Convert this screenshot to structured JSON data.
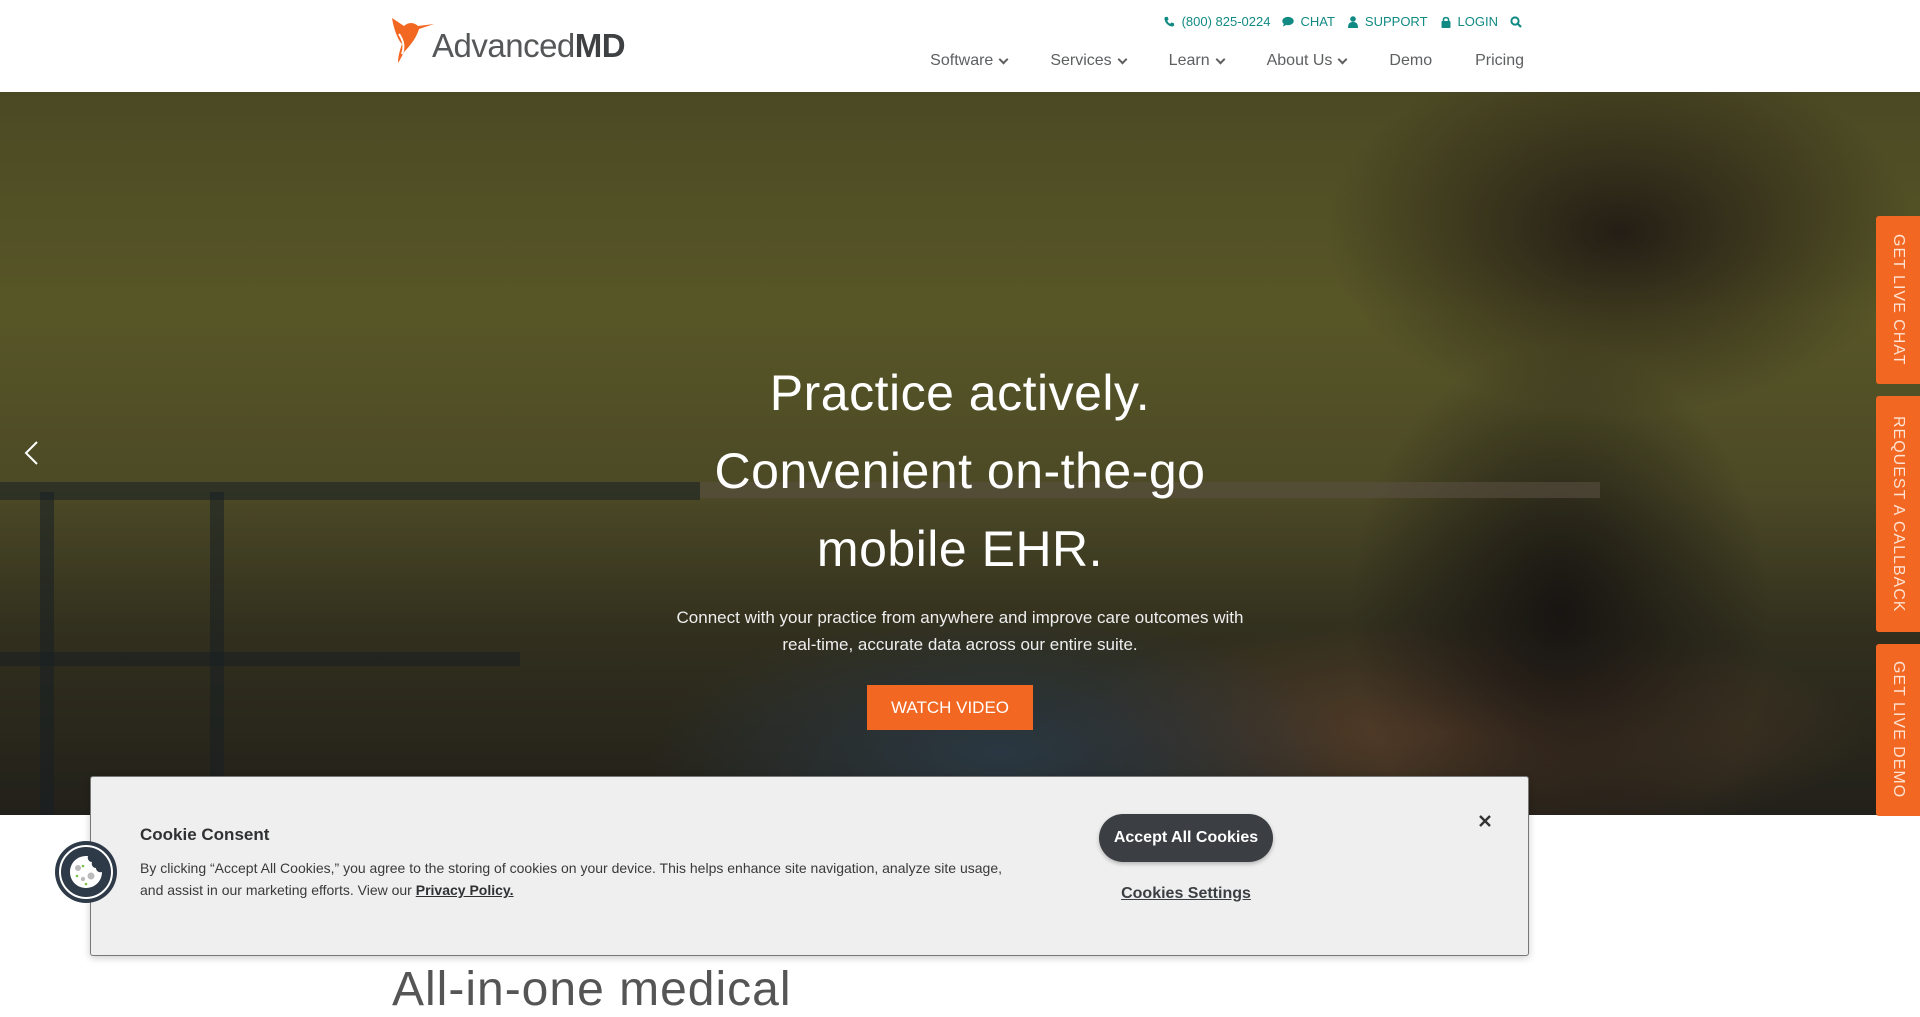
{
  "brand": {
    "name_light": "Advanced",
    "name_bold": "MD",
    "accent_color": "#f26722",
    "teal_color": "#128a84"
  },
  "utility_nav": {
    "phone": "(800) 825-0224",
    "chat": "CHAT",
    "support": "SUPPORT",
    "login": "LOGIN",
    "icons": [
      "phone-icon",
      "chat-bubble-icon",
      "user-icon",
      "lock-icon",
      "search-icon"
    ]
  },
  "main_nav": {
    "items": [
      {
        "label": "Software",
        "has_dropdown": true
      },
      {
        "label": "Services",
        "has_dropdown": true
      },
      {
        "label": "Learn",
        "has_dropdown": true
      },
      {
        "label": "About Us",
        "has_dropdown": true
      },
      {
        "label": "Demo",
        "has_dropdown": false
      },
      {
        "label": "Pricing",
        "has_dropdown": false
      }
    ]
  },
  "hero": {
    "title_lines": [
      "Practice actively.",
      "Convenient on-the-go",
      "mobile EHR."
    ],
    "subtitle_lines": [
      "Connect with your practice from anywhere and improve care outcomes with",
      "real-time, accurate data across our entire suite."
    ],
    "cta": "WATCH VIDEO"
  },
  "side_tabs": [
    "GET LIVE CHAT",
    "REQUEST A CALLBACK",
    "GET LIVE DEMO"
  ],
  "section": {
    "heading": "All-in-one medical"
  },
  "cookie_banner": {
    "title": "Cookie Consent",
    "text": "By clicking “Accept All Cookies,” you agree to the storing of cookies on your device. This helps enhance site navigation, analyze site usage, and assist in our marketing efforts. View our ",
    "policy_link": "Privacy Policy.",
    "accept_label": "Accept All Cookies",
    "settings_label": "Cookies Settings",
    "close_label": "×"
  }
}
